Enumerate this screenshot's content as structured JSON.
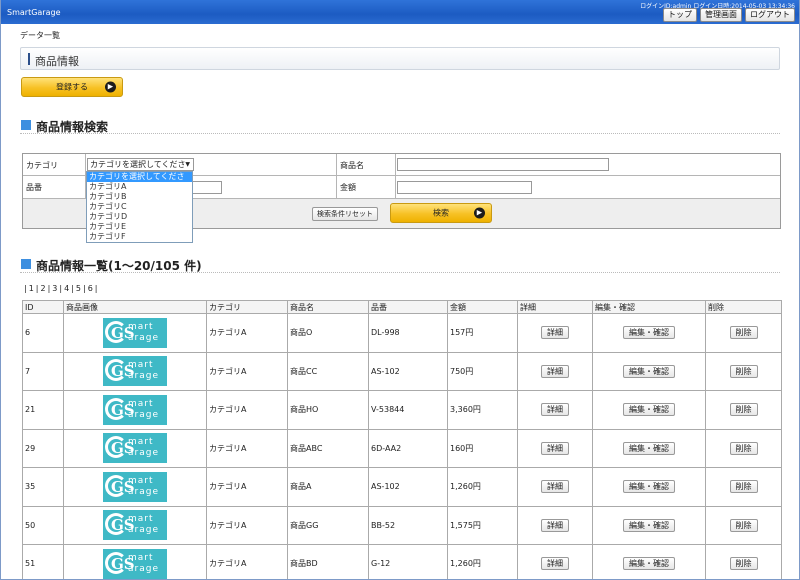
{
  "header": {
    "app_title": "SmartGarage",
    "login_info": "ログインID:admin ログイン日時:2014-05-03 13:34:36",
    "buttons": {
      "top": "トップ",
      "admin": "管理画面",
      "logout": "ログアウト"
    }
  },
  "breadcrumb": "データ一覧",
  "page_title": "商品情報",
  "register_button": "登録する",
  "search": {
    "section_title": "商品情報検索",
    "category_label": "カテゴリ",
    "category_selected": "カテゴリを選択してください",
    "category_options": [
      "カテゴリを選択してください",
      "カテゴリA",
      "カテゴリB",
      "カテゴリC",
      "カテゴリD",
      "カテゴリE",
      "カテゴリF"
    ],
    "name_label": "商品名",
    "code_label": "品番",
    "price_label": "金額",
    "reset_button": "検索条件リセット",
    "search_button": "検索"
  },
  "list": {
    "section_title": "商品情報一覧(1～20/105 件)",
    "pages": [
      "1",
      "2",
      "3",
      "4",
      "5",
      "6"
    ],
    "columns": [
      "ID",
      "商品画像",
      "カテゴリ",
      "商品名",
      "品番",
      "金額",
      "詳細",
      "編集・確認",
      "削除"
    ],
    "logo_text": {
      "line1": "mart",
      "line2": "arage",
      "mark": "GS"
    },
    "detail_button": "詳細",
    "edit_button": "編集・確認",
    "delete_button": "削除",
    "rows": [
      {
        "id": "6",
        "category": "カテゴリA",
        "name": "商品O",
        "code": "DL-998",
        "price": "157円"
      },
      {
        "id": "7",
        "category": "カテゴリA",
        "name": "商品CC",
        "code": "AS-102",
        "price": "750円"
      },
      {
        "id": "21",
        "category": "カテゴリA",
        "name": "商品HO",
        "code": "V-53844",
        "price": "3,360円"
      },
      {
        "id": "29",
        "category": "カテゴリA",
        "name": "商品ABC",
        "code": "6D-AA2",
        "price": "160円"
      },
      {
        "id": "35",
        "category": "カテゴリA",
        "name": "商品A",
        "code": "AS-102",
        "price": "1,260円"
      },
      {
        "id": "50",
        "category": "カテゴリA",
        "name": "商品GG",
        "code": "BB-52",
        "price": "1,575円"
      },
      {
        "id": "51",
        "category": "カテゴリA",
        "name": "商品BD",
        "code": "G-12",
        "price": "1,260円"
      }
    ]
  },
  "colors": {
    "header_blue": "#1c5bc2",
    "accent_gold": "#f7c125",
    "section_blue": "#3d8fe0",
    "logo_teal": "#3fb9c6"
  }
}
